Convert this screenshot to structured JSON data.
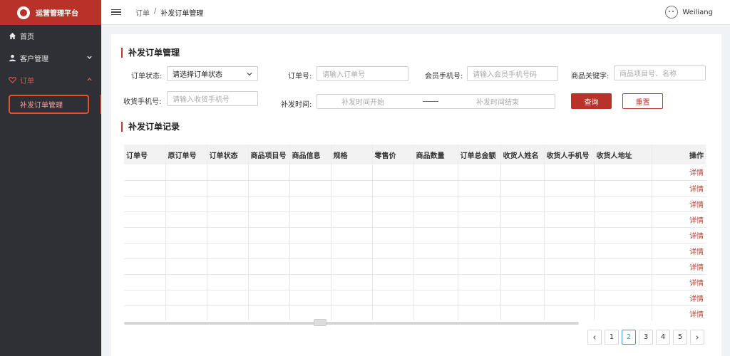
{
  "sidebar": {
    "brand_title": "运营管理平台",
    "items": [
      {
        "label": "首页",
        "icon": "home-icon"
      },
      {
        "label": "客户管理",
        "icon": "user-icon"
      },
      {
        "label": "订单",
        "icon": "heart-icon"
      }
    ],
    "sub_item": "补发订单管理"
  },
  "header": {
    "breadcrumb_root": "订单",
    "breadcrumb_sep": "/",
    "breadcrumb_current": "补发订单管理",
    "user_name": "Weiliang"
  },
  "filters": {
    "title": "补发订单管理",
    "order_status_label": "订单状态:",
    "order_status_value": "请选择订单状态",
    "order_no_label": "订单号:",
    "order_no_placeholder": "请输入订单号",
    "member_phone_label": "会员手机号:",
    "member_phone_placeholder": "请输入会员手机号码",
    "keyword_label": "商品关键字:",
    "keyword_placeholder": "商品项目号、名称",
    "receiver_phone_label": "收货手机号:",
    "receiver_phone_placeholder": "请输入收货手机号",
    "time_label": "补发时间:",
    "time_start_placeholder": "补发时间开始",
    "time_end_placeholder": "补发时间结束",
    "search_button": "查询",
    "reset_button": "重置"
  },
  "table": {
    "title": "补发订单记录",
    "columns": [
      "订单号",
      "原订单号",
      "订单状态",
      "商品项目号",
      "商品信息",
      "规格",
      "零售价",
      "商品数量",
      "订单总金额",
      "收货人姓名",
      "收货人手机号",
      "收货人地址"
    ],
    "op_column": "操作",
    "row_action": "详情",
    "row_count": 10
  },
  "pagination": {
    "prev": "<",
    "pages": [
      "1",
      "2",
      "3",
      "4",
      "5"
    ],
    "current": "2",
    "next": ">"
  },
  "colors": {
    "accent": "#b8322a",
    "sidebar_bg": "#2f3035",
    "link": "#c0392b",
    "pager_active": "#4a90d9"
  }
}
